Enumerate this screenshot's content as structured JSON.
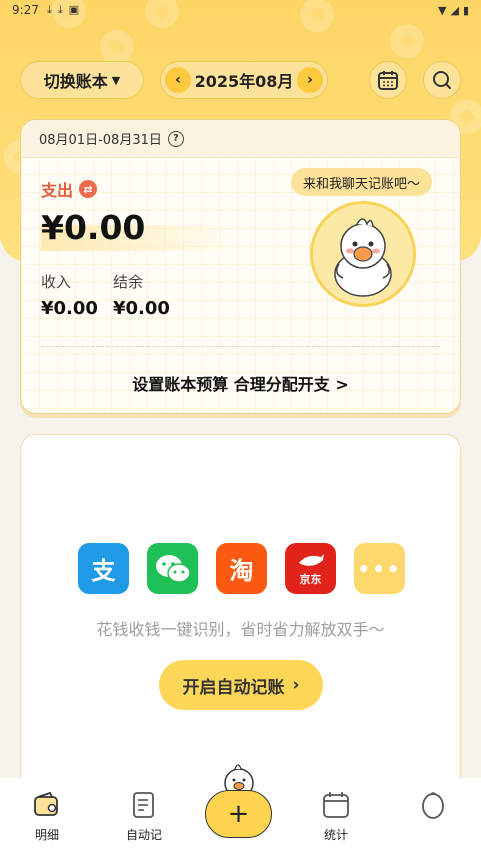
{
  "status_bar": {
    "time": "9:27"
  },
  "header": {
    "book_switch_label": "切换账本",
    "month_label": "2025年08月"
  },
  "summary": {
    "date_range": "08月01日-08月31日",
    "expense_label": "支出",
    "expense_amount": "¥0.00",
    "income_label": "收入",
    "income_value": "¥0.00",
    "balance_label": "结余",
    "balance_value": "¥0.00",
    "chat_bubble": "来和我聊天记账吧～",
    "budget_link": "设置账本预算 合理分配开支 >"
  },
  "auto_record": {
    "apps": [
      {
        "name": "alipay",
        "glyph": "支",
        "color": "#1e9ae6"
      },
      {
        "name": "wechat",
        "glyph": "",
        "color": "#1fc156"
      },
      {
        "name": "taobao",
        "glyph": "淘",
        "color": "#fc5a12"
      },
      {
        "name": "jd",
        "glyph": "京东",
        "color": "#e2231a"
      },
      {
        "name": "more",
        "glyph": "•••",
        "color": "#fdd86a"
      }
    ],
    "description": "花钱收钱一键识别，省时省力解放双手～",
    "button_label": "开启自动记账"
  },
  "bottom_nav": {
    "items": [
      {
        "label": "明细"
      },
      {
        "label": "自动记"
      },
      {
        "label": "统计"
      },
      {
        "label": ""
      }
    ],
    "fab_label": "+"
  },
  "colors": {
    "brand_yellow": "#fdd565",
    "expense_red": "#e85a3c",
    "button_yellow": "#fed658"
  }
}
